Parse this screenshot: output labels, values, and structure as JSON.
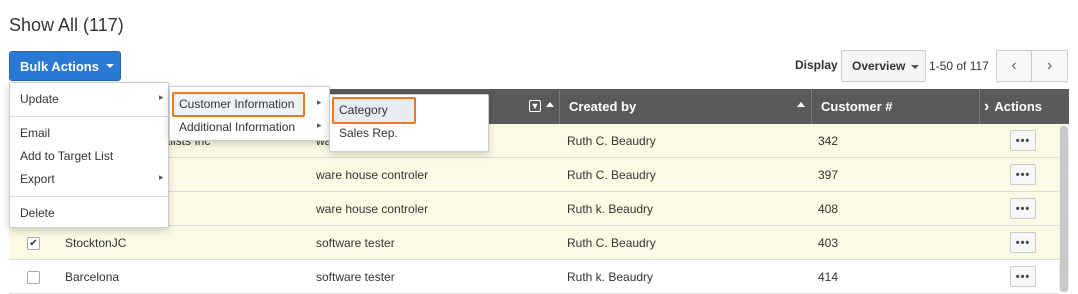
{
  "page": {
    "title": "Show All (117)"
  },
  "toolbar": {
    "bulk_actions_label": "Bulk Actions",
    "display_label": "Display",
    "display_value": "Overview",
    "range_text": "1-50 of 117",
    "prev_glyph": "‹",
    "next_glyph": "›"
  },
  "table": {
    "headers": {
      "created_by": "Created by",
      "customer_no": "Customer #",
      "actions": "Actions",
      "actions_glyph": "›"
    },
    "filter_glyph": "▼",
    "dots": "•••",
    "check_glyph": "✔",
    "rows": [
      {
        "name": "",
        "partial_name": "nalists Inc",
        "title": "",
        "partial_title": "wa",
        "created_by": "Ruth C. Beaudry",
        "customer_no": "342",
        "checked": false
      },
      {
        "name": "",
        "title": "ware house controler",
        "created_by": "Ruth C. Beaudry",
        "customer_no": "397",
        "checked": false
      },
      {
        "name": "",
        "title": "ware house controler",
        "created_by": "Ruth k. Beaudry",
        "customer_no": "408",
        "checked": false
      },
      {
        "name": "StocktonJC",
        "title": "software tester",
        "created_by": "Ruth C. Beaudry",
        "customer_no": "403",
        "checked": true
      },
      {
        "name": "Barcelona",
        "title": "software tester",
        "created_by": "Ruth k. Beaudry",
        "customer_no": "414",
        "checked": false
      }
    ]
  },
  "menus": {
    "bulk": {
      "update": "Update",
      "email": "Email",
      "add_to_target_list": "Add to Target List",
      "export": "Export",
      "delete": "Delete",
      "arrow": "▸"
    },
    "update_sub": {
      "customer_information": "Customer Information",
      "additional_information": "Additional Information",
      "arrow": "▸"
    },
    "customer_info_sub": {
      "category": "Category",
      "sales_rep": "Sales Rep."
    }
  },
  "colors": {
    "primary": "#2a7ad5",
    "header_bg": "#5a5a5a",
    "highlight_row": "#fbfbe5",
    "focus_outline": "#f0781e"
  }
}
